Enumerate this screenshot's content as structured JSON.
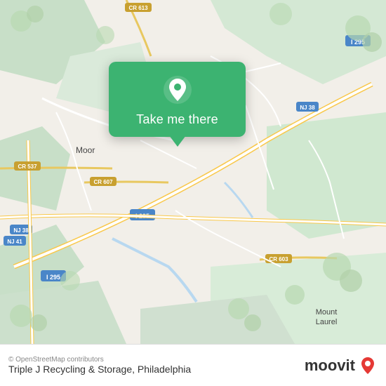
{
  "map": {
    "alt": "Map of Philadelphia area showing Triple J Recycling & Storage location"
  },
  "popup": {
    "button_label": "Take me there"
  },
  "info_bar": {
    "copyright": "© OpenStreetMap contributors",
    "location_name": "Triple J Recycling & Storage, Philadelphia",
    "moovit_text": "moovit"
  }
}
